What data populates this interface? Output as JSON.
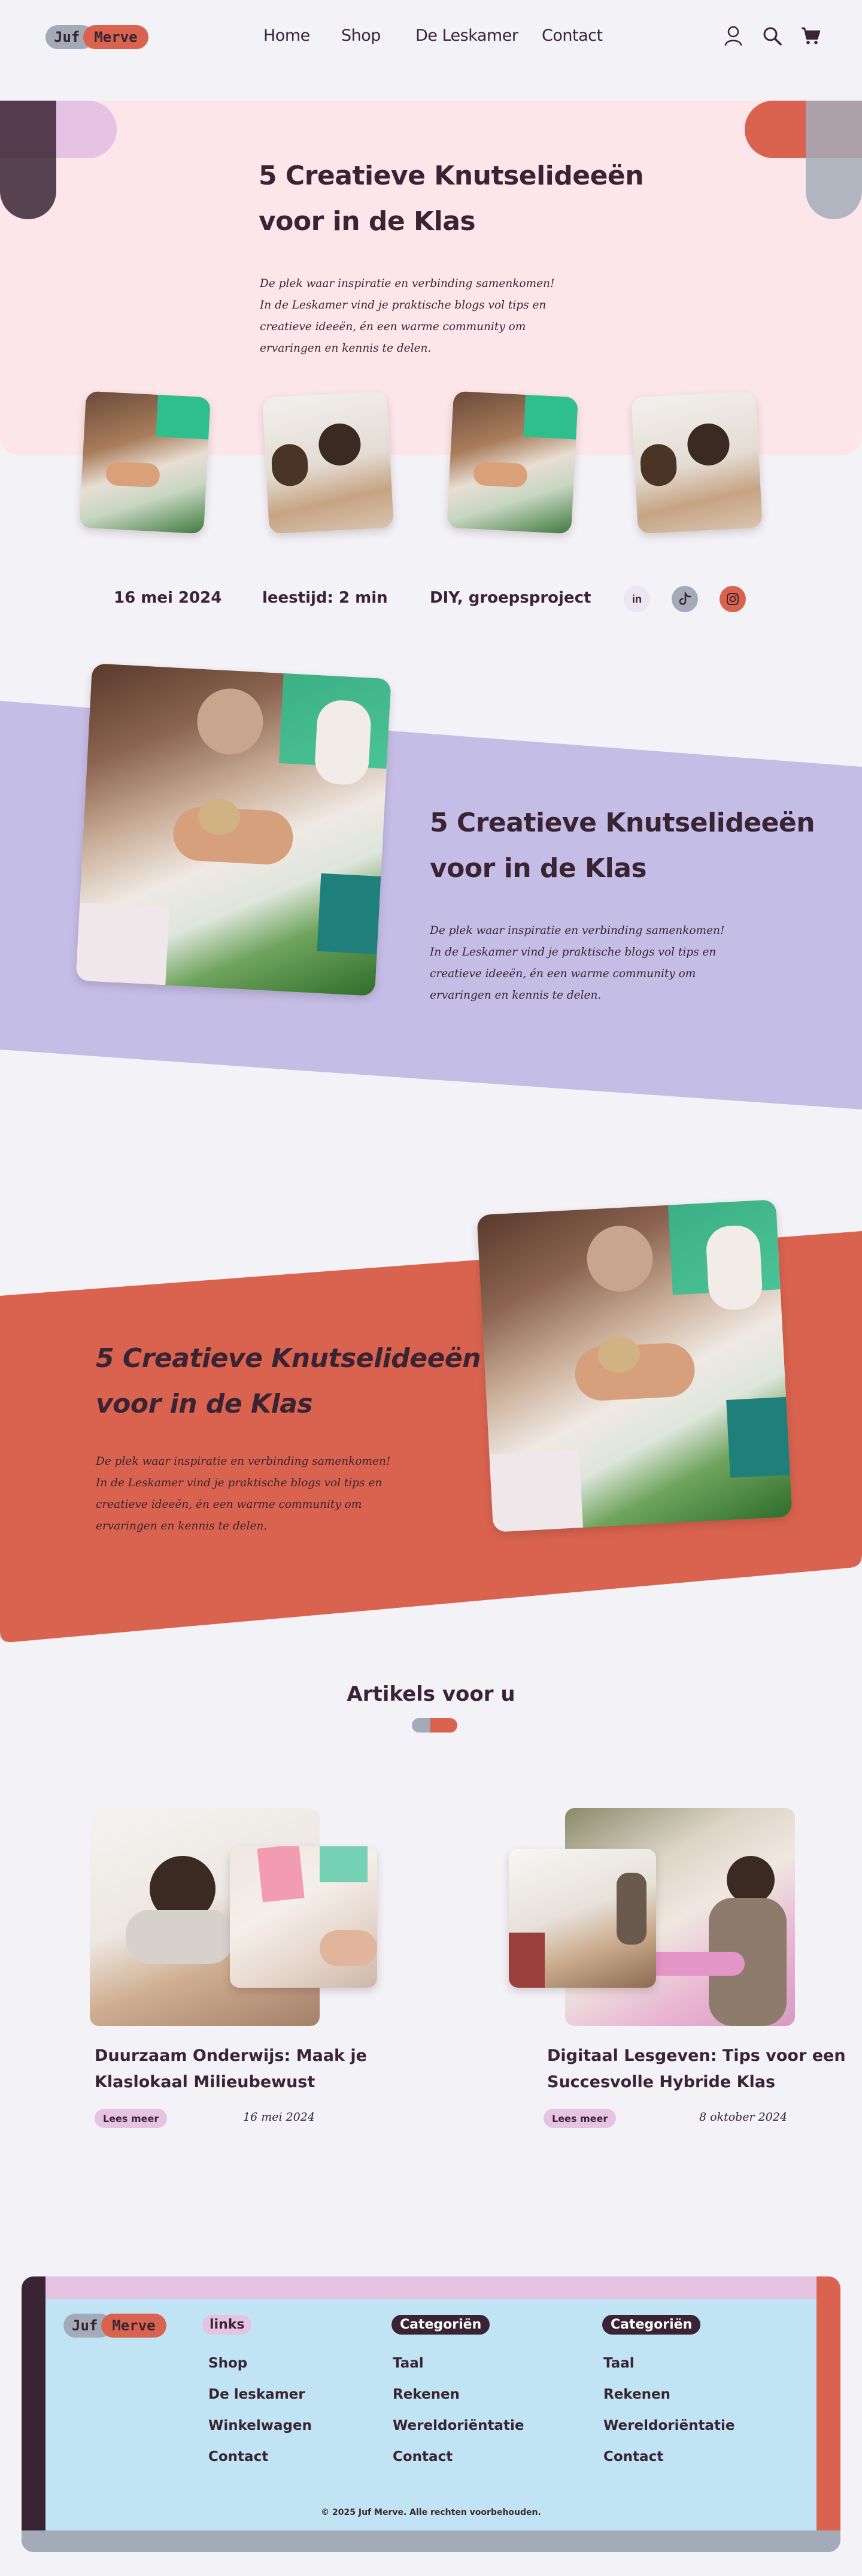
{
  "brand": {
    "part1": "Juf",
    "part2": "Merve"
  },
  "nav": {
    "items": [
      "Home",
      "Shop",
      "De Leskamer",
      "Contact"
    ]
  },
  "header_icons": [
    "user-icon",
    "search-icon",
    "cart-icon"
  ],
  "hero": {
    "title_line1": "5 Creatieve Knutselideeën",
    "title_line2": "voor in de Klas",
    "para_lines": [
      "De plek waar inspiratie en verbinding samenkomen!",
      "In de Leskamer vind je praktische blogs vol tips en",
      "creatieve ideeën, én een warme community om",
      "ervaringen en kennis te delen."
    ]
  },
  "meta": {
    "date": "16 mei 2024",
    "read_time": "leestijd: 2 min",
    "category": "DIY, groepsproject",
    "social": [
      "in",
      "tiktok-icon",
      "instagram-icon"
    ]
  },
  "section_purple": {
    "title_line1": "5 Creatieve Knutselideeën",
    "title_line2": "voor in de Klas",
    "para_lines": [
      "De plek waar inspiratie en verbinding samenkomen!",
      "In de Leskamer vind je praktische blogs vol tips en",
      "creatieve ideeën, én een warme community om",
      "ervaringen en kennis te delen."
    ]
  },
  "section_orange": {
    "title_line1": "5 Creatieve Knutselideeën",
    "title_line2": "voor in de Klas",
    "para_lines": [
      "De plek waar inspiratie en verbinding samenkomen!",
      "In de Leskamer vind je praktische blogs vol tips en",
      "creatieve ideeën, én een warme community om",
      "ervaringen en kennis te delen."
    ]
  },
  "articles": {
    "heading": "Artikels voor u",
    "items": [
      {
        "title_line1": "Duurzaam Onderwijs: Maak je",
        "title_line2": "Klaslokaal Milieubewust",
        "button": "Lees meer",
        "date": "16 mei 2024"
      },
      {
        "title_line1": "Digitaal Lesgeven: Tips voor een",
        "title_line2": "Succesvolle Hybride Klas",
        "button": "Lees meer",
        "date": "8 oktober 2024"
      }
    ]
  },
  "footer": {
    "links_heading": "links",
    "links": [
      "Shop",
      "De leskamer",
      "Winkelwagen",
      "Contact"
    ],
    "cat1_heading": "Categoriën",
    "cat1": [
      "Taal",
      "Rekenen",
      "Wereldoriëntatie",
      "Contact"
    ],
    "cat2_heading": "Categoriën",
    "cat2": [
      "Taal",
      "Rekenen",
      "Wereldoriëntatie",
      "Contact"
    ],
    "copyright": "© 2025 Juf Merve. Alle rechten voorbehouden."
  },
  "colors": {
    "background": "#f3f2f7",
    "hero_pink": "#fce6ea",
    "purple": "#c4bde6",
    "orange": "#d9634e",
    "plum": "#3a2434",
    "lilac": "#e6c2e3",
    "grey_blue": "#a3abb8",
    "footer_blue": "#c0e4f4"
  }
}
